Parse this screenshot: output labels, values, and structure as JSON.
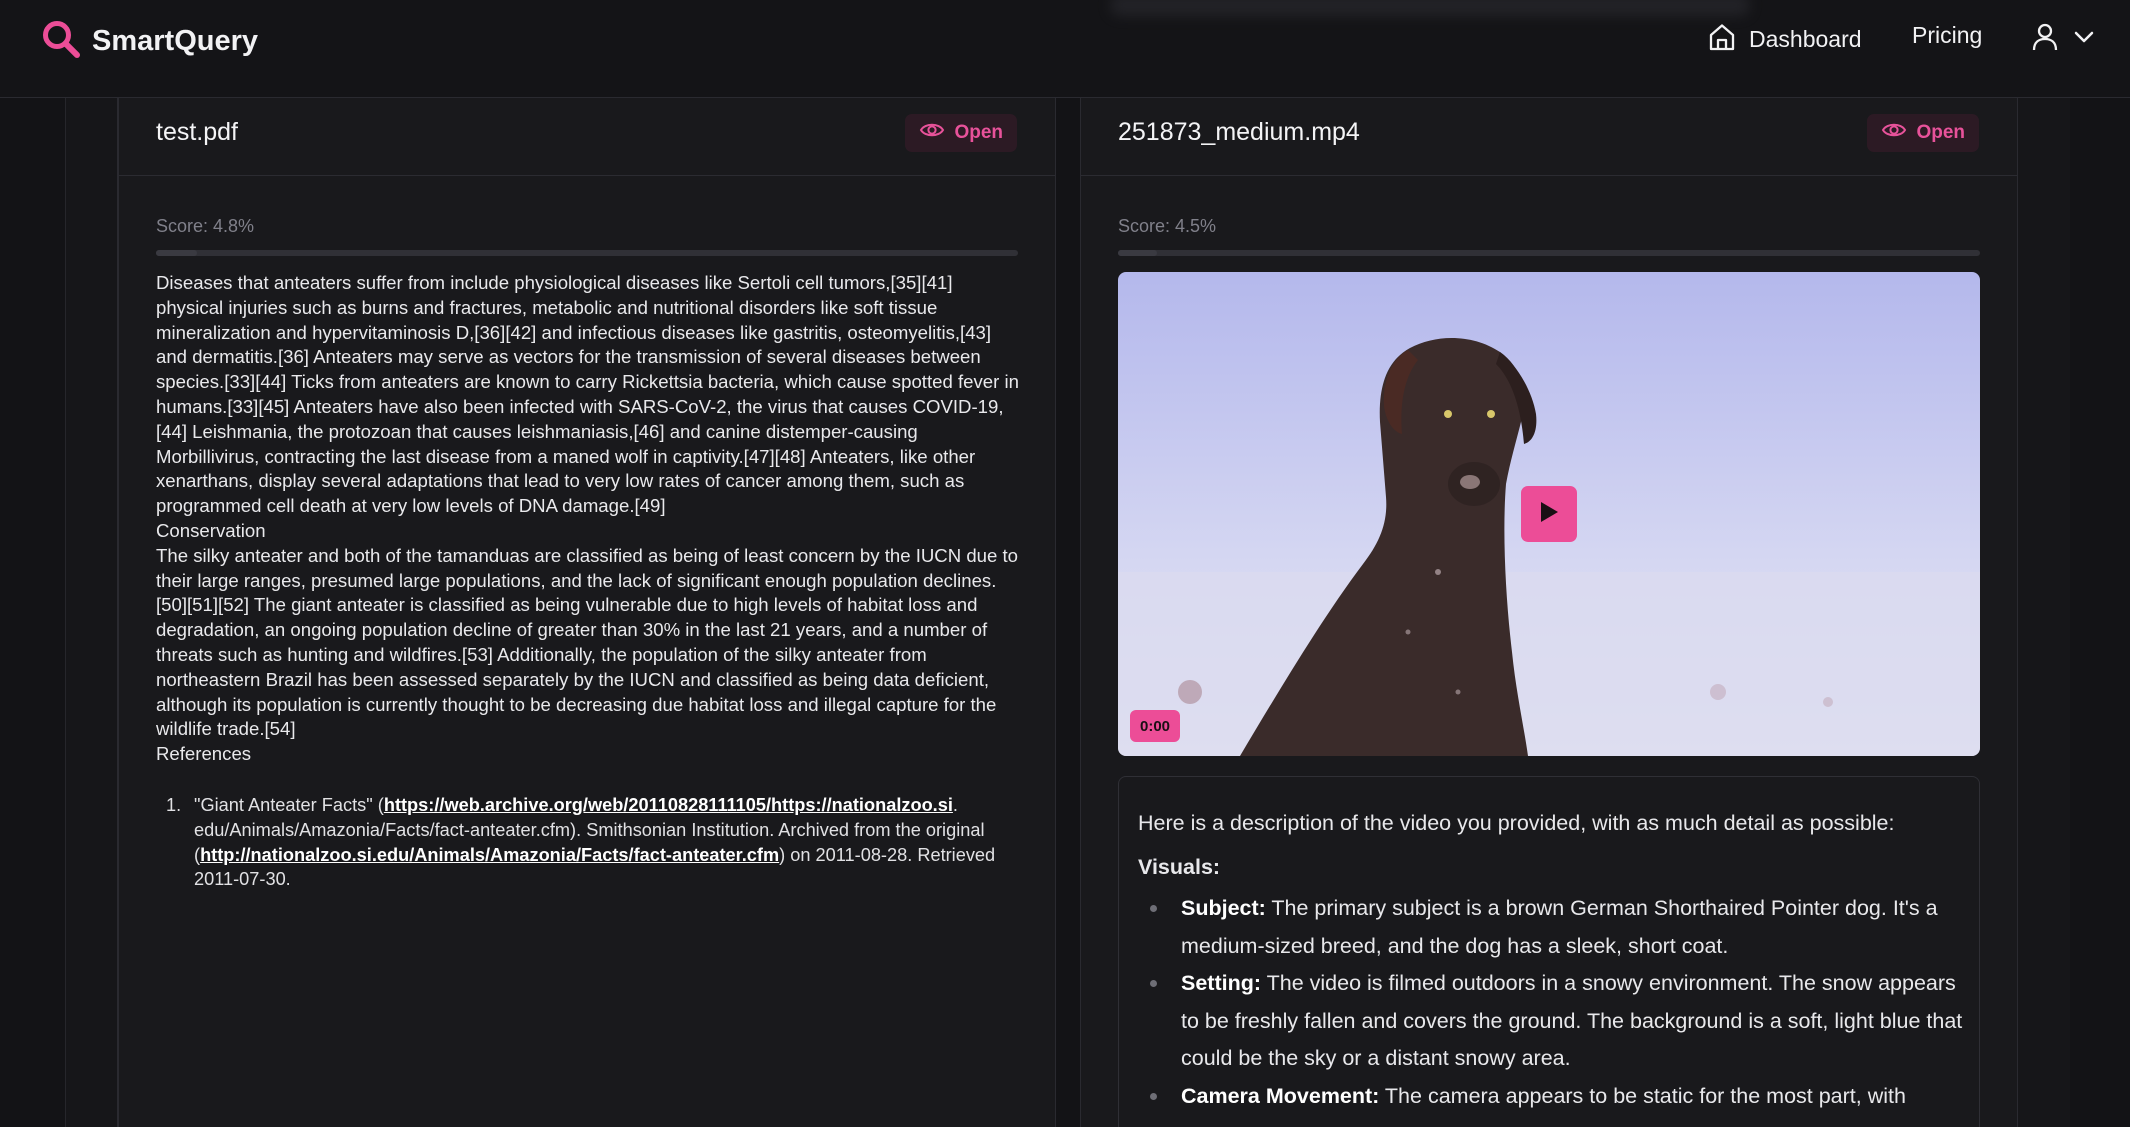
{
  "header": {
    "brand": "SmartQuery",
    "nav": [
      {
        "label": "Dashboard",
        "icon": "home-icon"
      },
      {
        "label": "Pricing"
      }
    ],
    "user_icon": "user-icon",
    "accent": "#ec4d97"
  },
  "results": [
    {
      "title": "test.pdf",
      "open_label": "Open",
      "score": "Score: 4.8%",
      "score_value": 4.8,
      "paragraphs": [
        "Diseases that anteaters suffer from include physiological diseases like Sertoli cell tumors,[35][41] physical injuries such as burns and fractures, metabolic and nutritional disorders like soft tissue mineralization and hypervitaminosis D,[36][42] and infectious diseases like gastritis, osteomyelitis,[43] and dermatitis.[36] Anteaters may serve as vectors for the transmission of several diseases between species.[33][44] Ticks from anteaters are known to carry Rickettsia bacteria, which cause spotted fever in humans.[33][45] Anteaters have also been infected with SARS-CoV-2, the virus that causes COVID-19,[44] Leishmania, the protozoan that causes leishmaniasis,[46] and canine distemper-causing Morbillivirus, contracting the last disease from a maned wolf in captivity.[47][48] Anteaters, like other xenarthans, display several adaptations that lead to very low rates of cancer among them, such as programmed cell death at very low levels of DNA damage.[49]",
        "Conservation",
        "The silky anteater and both of the tamanduas are classified as being of least concern by the IUCN due to their large ranges, presumed large populations, and the lack of significant enough population declines.[50][51][52] The giant anteater is classified as being vulnerable due to high levels of habitat loss and degradation, an ongoing population decline of greater than 30% in the last 21 years, and a number of threats such as hunting and wildfires.[53] Additionally, the population of the silky anteater from northeastern Brazil has been assessed separately by the IUCN and classified as being data deficient, although its population is currently thought to be decreasing due habitat loss and illegal capture for the wildlife trade.[54]",
        "References"
      ],
      "reference": {
        "number": "1.",
        "prefix": "\"Giant Anteater Facts\" (",
        "link1": "https://web.archive.org/web/20110828111105/https://nationalzoo.si",
        "middle": ". edu/Animals/Amazonia/Facts/fact-anteater.cfm). Smithsonian Institution. Archived from the original (",
        "link2": "http://nationalzoo.si.edu/Animals/Amazonia/Facts/fact-anteater.cfm",
        "suffix": ") on 2011-08-28. Retrieved 2011-07-30."
      }
    },
    {
      "title": "251873_medium.mp4",
      "open_label": "Open",
      "score": "Score: 4.5%",
      "score_value": 4.5,
      "video_time": "0:00",
      "description": {
        "intro": "Here is a description of the video you provided, with as much detail as possible:",
        "visuals_heading": "Visuals:",
        "bullets": [
          {
            "term": "Subject:",
            "text": " The primary subject is a brown German Shorthaired Pointer dog. It's a medium-sized breed, and the dog has a sleek, short coat."
          },
          {
            "term": "Setting:",
            "text": " The video is filmed outdoors in a snowy environment. The snow appears to be freshly fallen and covers the ground. The background is a soft, light blue that could be the sky or a distant snowy area."
          },
          {
            "term": "Camera Movement:",
            "text": " The camera appears to be static for the most part, with"
          }
        ]
      }
    }
  ]
}
